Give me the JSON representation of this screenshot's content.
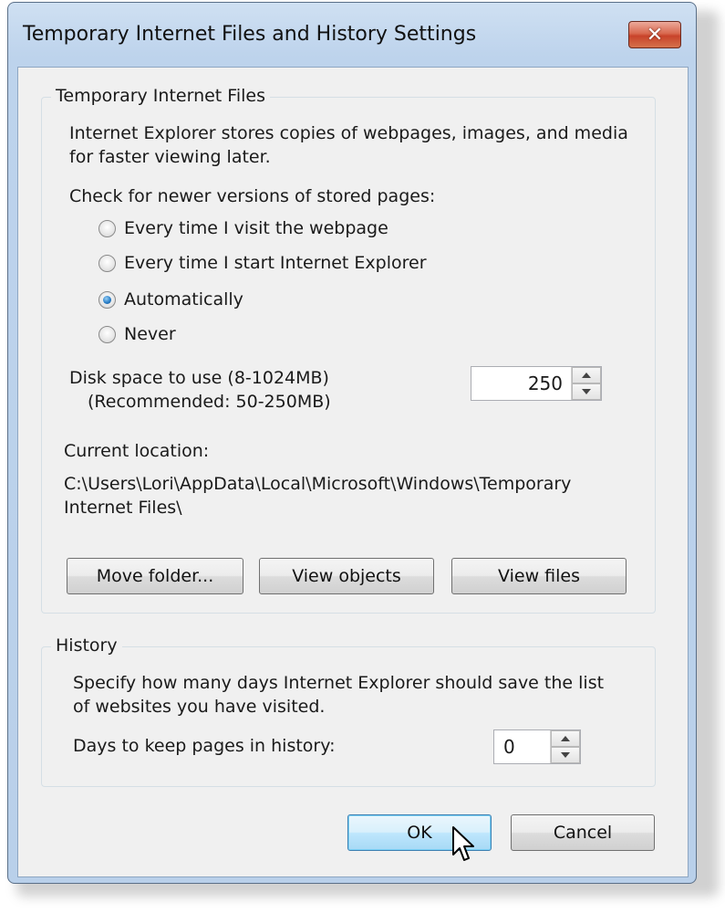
{
  "window": {
    "title": "Temporary Internet Files and History Settings",
    "close_symbol": "✕"
  },
  "temp_files": {
    "group_title": "Temporary Internet Files",
    "description_line1": "Internet Explorer stores copies of webpages, images, and media",
    "description_line2": "for faster viewing later.",
    "check_label": "Check for newer versions of stored pages:",
    "options": [
      {
        "label": "Every time I visit the webpage",
        "checked": false
      },
      {
        "label": "Every time I start Internet Explorer",
        "checked": false
      },
      {
        "label": "Automatically",
        "checked": true
      },
      {
        "label": "Never",
        "checked": false
      }
    ],
    "disk_space_label": "Disk space to use (8-1024MB)",
    "disk_space_recommended": "(Recommended: 50-250MB)",
    "disk_space_value": "250",
    "current_location_label": "Current location:",
    "current_location_line1": "C:\\Users\\Lori\\AppData\\Local\\Microsoft\\Windows\\Temporary",
    "current_location_line2": "Internet Files\\",
    "buttons": {
      "move_folder": "Move folder...",
      "view_objects": "View objects",
      "view_files": "View files"
    }
  },
  "history": {
    "group_title": "History",
    "description_line1": "Specify how many days Internet Explorer should save the list",
    "description_line2": "of websites you have visited.",
    "days_label": "Days to keep pages in history:",
    "days_value": "0"
  },
  "footer": {
    "ok_label": "OK",
    "cancel_label": "Cancel"
  },
  "icons": {
    "close": "close-icon",
    "spin_up": "spin-up-icon",
    "spin_down": "spin-down-icon",
    "cursor": "mouse-pointer-icon"
  }
}
